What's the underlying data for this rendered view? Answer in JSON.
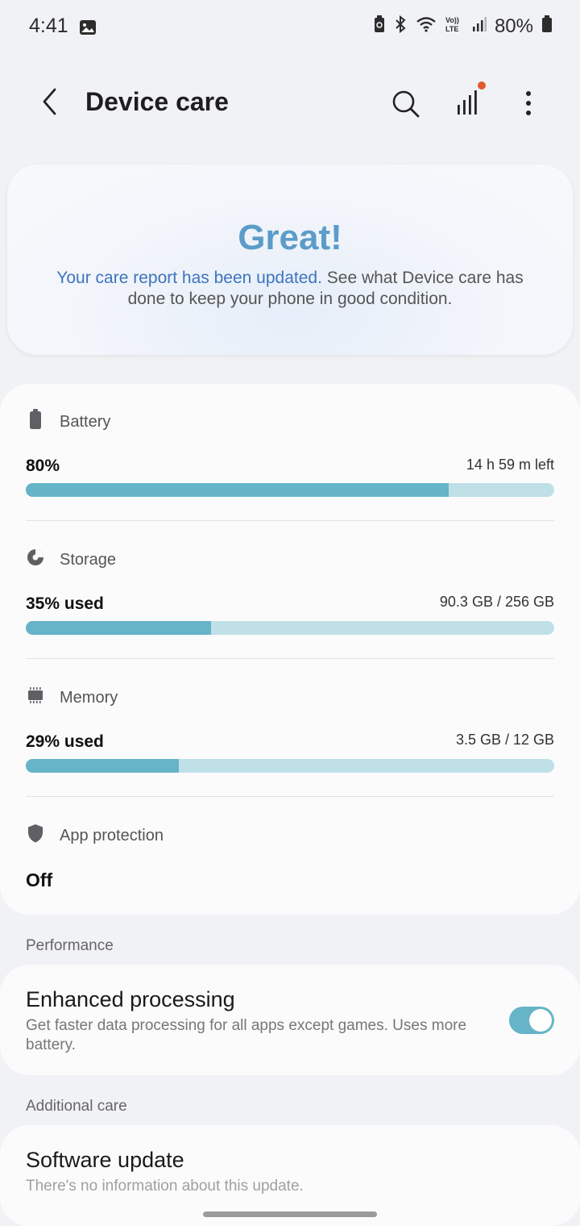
{
  "status": {
    "time": "4:41",
    "battery_percent": "80%"
  },
  "header": {
    "title": "Device care",
    "icons": [
      "back-icon",
      "search-icon",
      "signal-bars-icon",
      "more-vert-icon"
    ],
    "notification_dot_color": "#e05a2c"
  },
  "hero": {
    "title": "Great!",
    "link_text": "Your care report has been updated.",
    "text": " See what Device care has done to keep your phone in good condition."
  },
  "stats": {
    "battery": {
      "label": "Battery",
      "value": "80%",
      "detail": "14 h 59 m left",
      "level": 0.8,
      "icon": "battery-icon"
    },
    "storage": {
      "label": "Storage",
      "value": "35% used",
      "detail": "90.3 GB / 256 GB",
      "level": 0.35,
      "icon": "pie-chart-icon"
    },
    "memory": {
      "label": "Memory",
      "value": "29% used",
      "detail": "3.5 GB / 12 GB",
      "level": 0.29,
      "icon": "chip-icon"
    },
    "app_protection": {
      "label": "App protection",
      "value": "Off",
      "icon": "shield-icon"
    }
  },
  "performance": {
    "section_label": "Performance",
    "enhanced": {
      "title": "Enhanced processing",
      "description": "Get faster data processing for all apps except games. Uses more battery.",
      "enabled": true
    }
  },
  "additional": {
    "section_label": "Additional care",
    "software_update": {
      "title": "Software update",
      "description": "There's no information about this update."
    }
  },
  "colors": {
    "accent": "#65b4c8",
    "bar_track": "#bfe0e7",
    "hero_title": "#5b9cc9",
    "hero_link": "#3e74bd"
  }
}
